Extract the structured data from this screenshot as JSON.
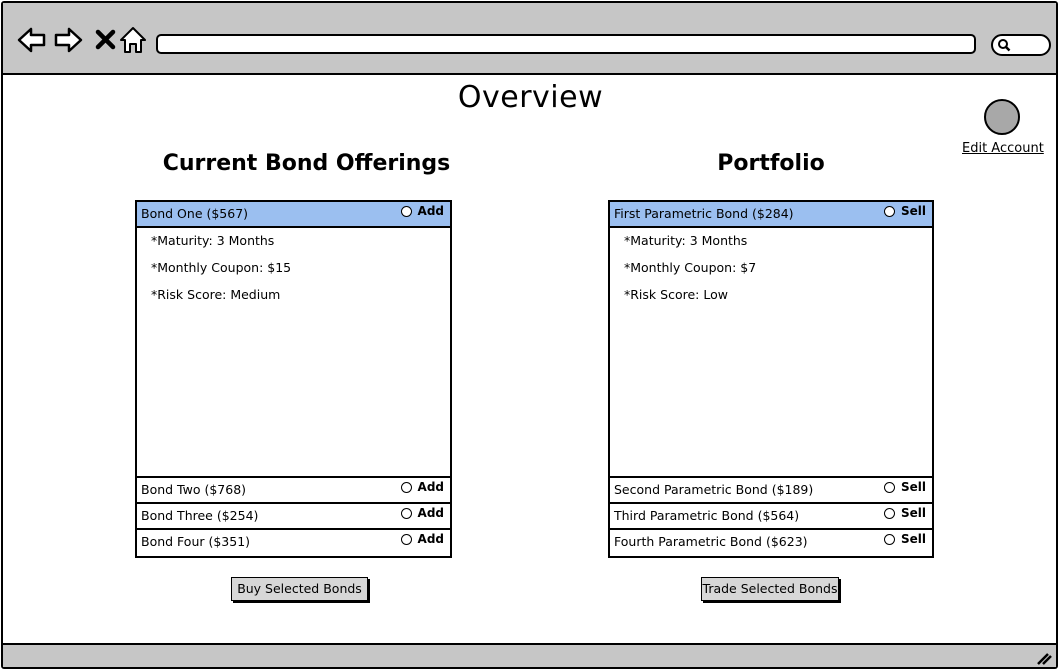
{
  "page": {
    "title": "Overview"
  },
  "account": {
    "edit_label": "Edit Account"
  },
  "offerings": {
    "heading": "Current Bond Offerings",
    "action_label": "Add",
    "selected": {
      "label": "Bond One ($567)",
      "details": [
        "*Maturity: 3 Months",
        "*Monthly Coupon: $15",
        "*Risk Score: Medium"
      ]
    },
    "others": [
      "Bond Two ($768)",
      "Bond Three ($254)",
      "Bond Four ($351)"
    ],
    "button_label": "Buy Selected Bonds"
  },
  "portfolio": {
    "heading": "Portfolio",
    "action_label": "Sell",
    "selected": {
      "label": "First Parametric Bond ($284)",
      "details": [
        "*Maturity: 3 Months",
        "*Monthly Coupon: $7",
        "*Risk Score: Low"
      ]
    },
    "others": [
      "Second Parametric Bond ($189)",
      "Third Parametric Bond ($564)",
      "Fourth Parametric Bond ($623)"
    ],
    "button_label": "Trade Selected Bonds"
  },
  "colors": {
    "selected_row": "#9bbff0",
    "chrome": "#c6c6c6"
  }
}
